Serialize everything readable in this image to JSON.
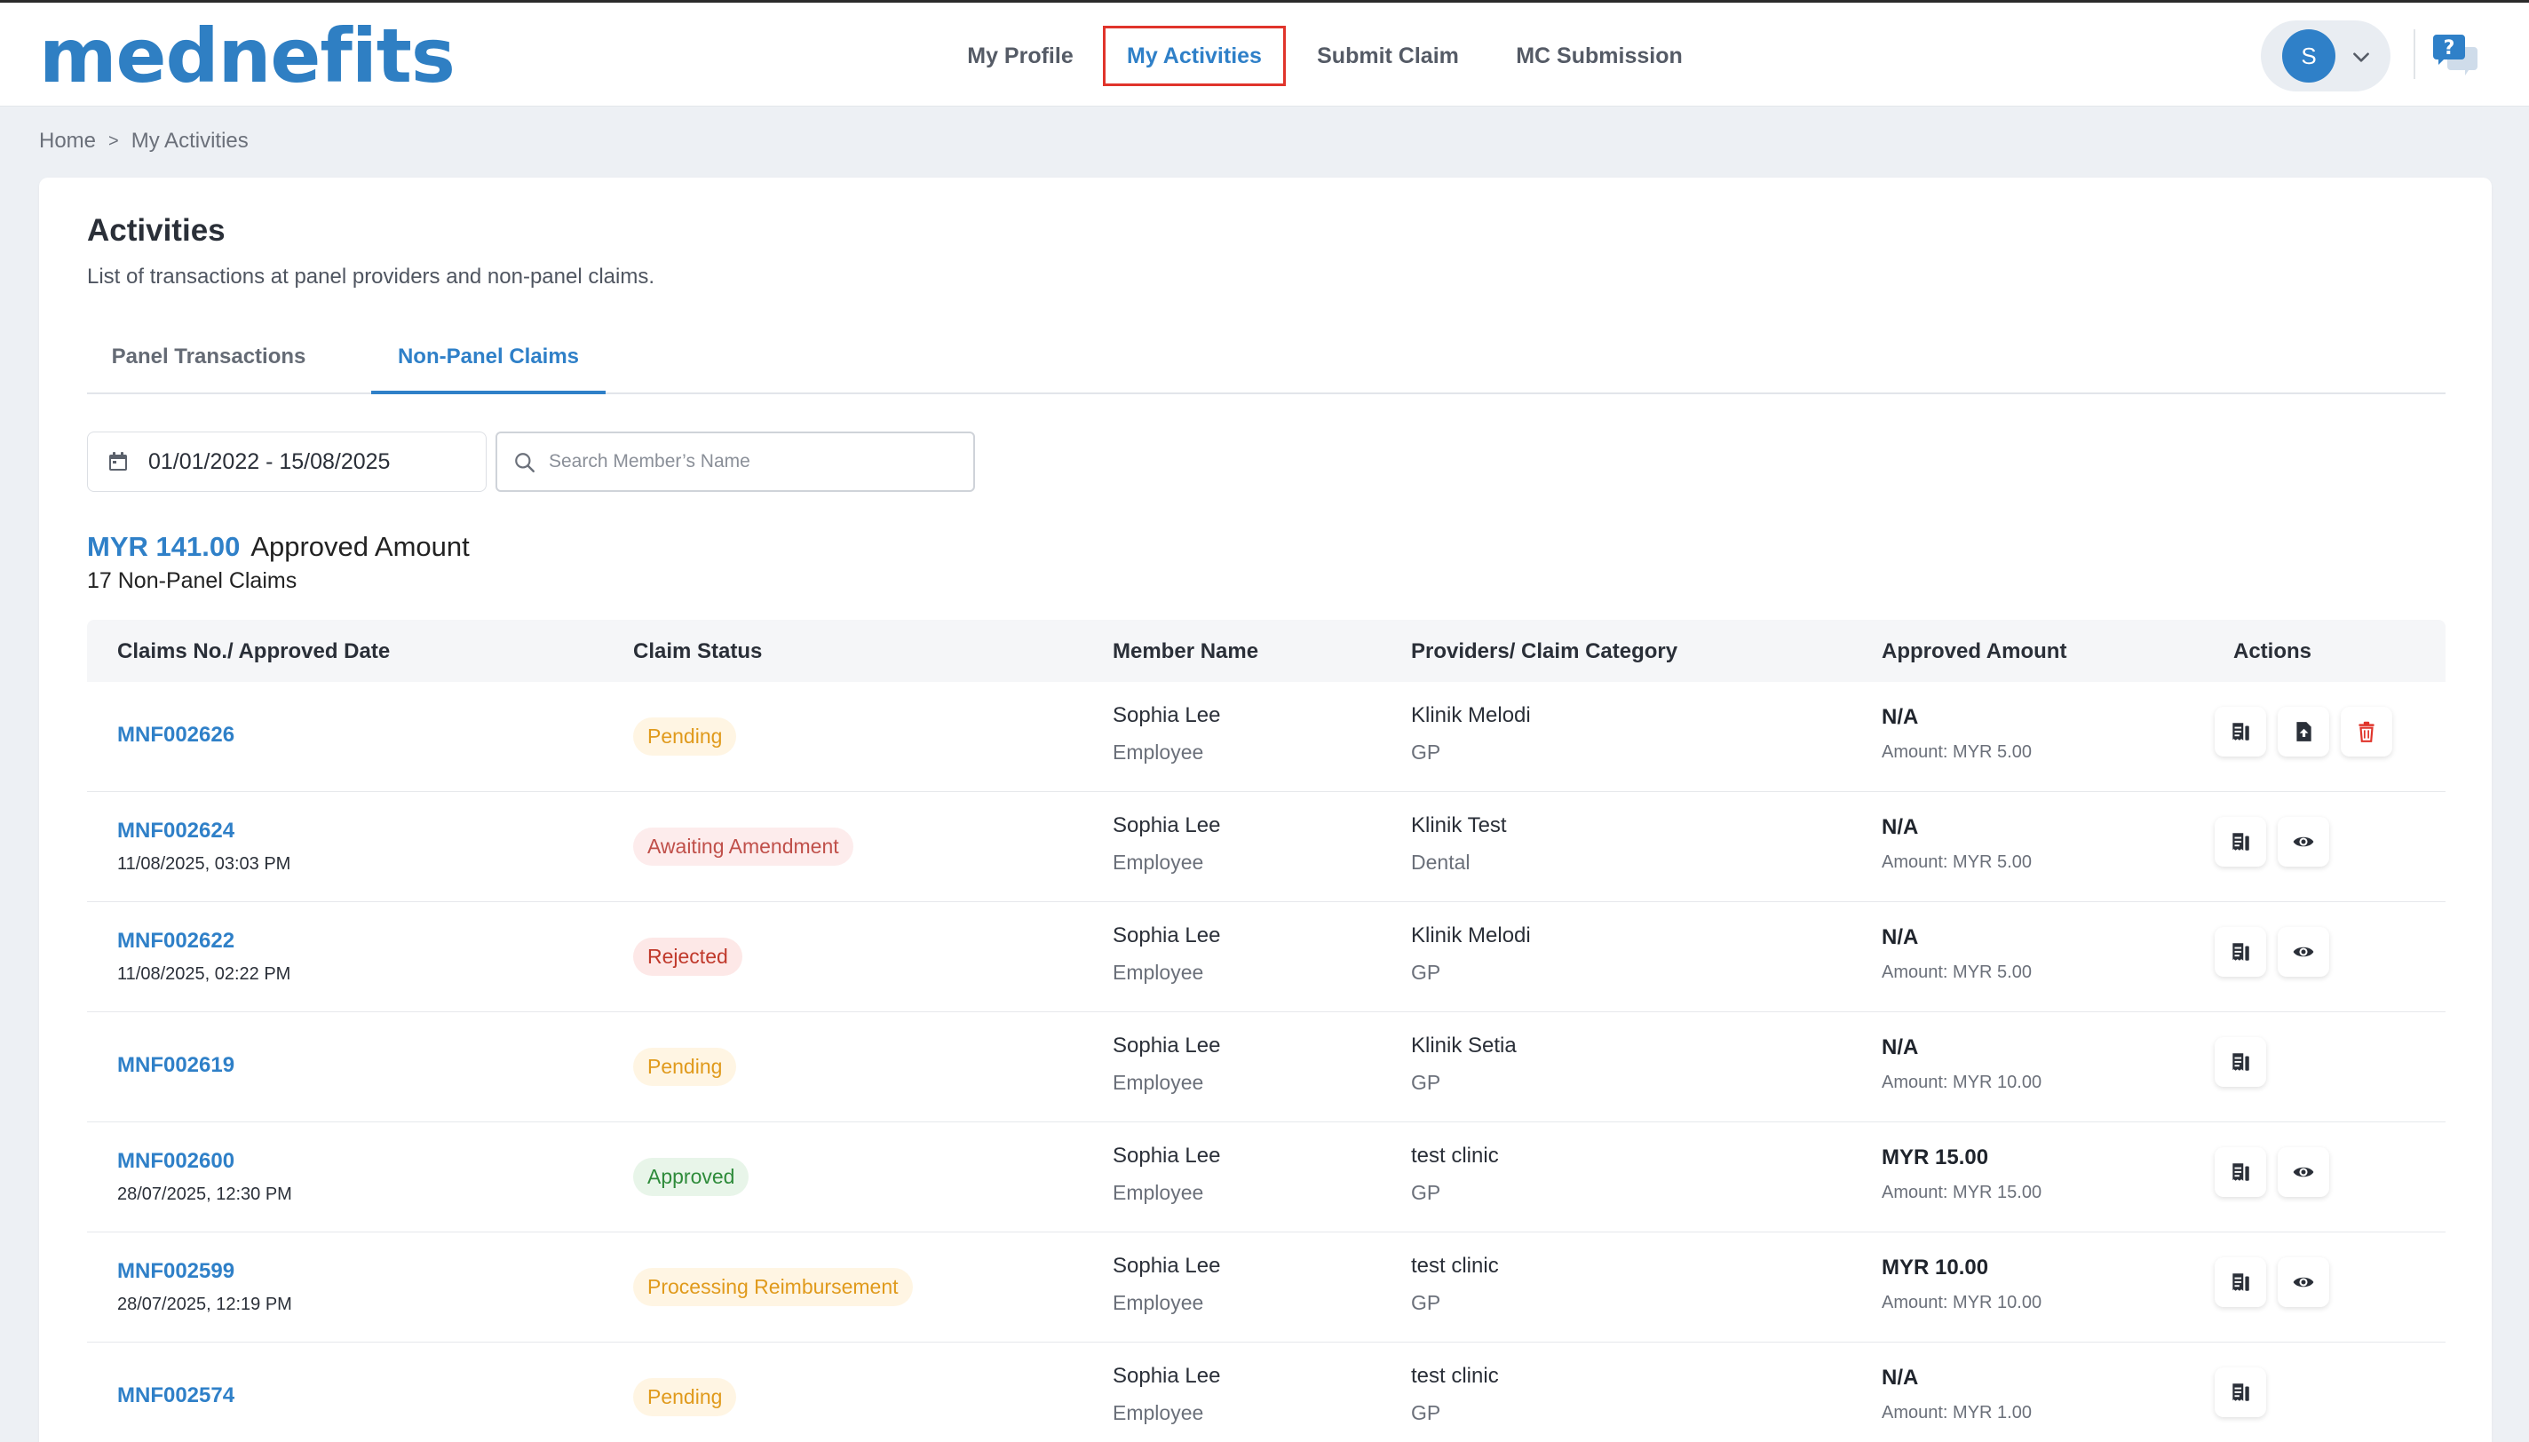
{
  "header": {
    "logo": "mednefits",
    "nav": [
      {
        "label": "My Profile",
        "active": false
      },
      {
        "label": "My Activities",
        "active": true
      },
      {
        "label": "Submit Claim",
        "active": false
      },
      {
        "label": "MC Submission",
        "active": false
      }
    ],
    "user_initial": "S"
  },
  "breadcrumb": {
    "home": "Home",
    "separator": ">",
    "current": "My Activities"
  },
  "page": {
    "title": "Activities",
    "subtitle": "List of transactions at panel providers and non-panel claims."
  },
  "tabs": [
    {
      "label": "Panel Transactions",
      "active": false
    },
    {
      "label": "Non-Panel Claims",
      "active": true
    }
  ],
  "filters": {
    "date_range": "01/01/2022 - 15/08/2025",
    "search_placeholder": "Search Member’s Name"
  },
  "summary": {
    "approved_amount": "MYR 141.00",
    "approved_label": "Approved Amount",
    "count_label": "17 Non-Panel Claims"
  },
  "table": {
    "headers": [
      "Claims No./ Approved Date",
      "Claim Status",
      "Member Name",
      "Providers/ Claim Category",
      "Approved Amount",
      "Actions"
    ],
    "rows": [
      {
        "claim_no": "MNF002626",
        "date": "",
        "status": "Pending",
        "status_type": "pending",
        "member": "Sophia Lee",
        "member_type": "Employee",
        "provider": "Klinik Melodi",
        "category": "GP",
        "approved": "N/A",
        "amount": "Amount: MYR 5.00",
        "actions": [
          "receipt",
          "upload",
          "delete"
        ]
      },
      {
        "claim_no": "MNF002624",
        "date": "11/08/2025, 03:03 PM",
        "status": "Awaiting Amendment",
        "status_type": "await",
        "member": "Sophia Lee",
        "member_type": "Employee",
        "provider": "Klinik Test",
        "category": "Dental",
        "approved": "N/A",
        "amount": "Amount: MYR 5.00",
        "actions": [
          "receipt",
          "view"
        ]
      },
      {
        "claim_no": "MNF002622",
        "date": "11/08/2025, 02:22 PM",
        "status": "Rejected",
        "status_type": "rejected",
        "member": "Sophia Lee",
        "member_type": "Employee",
        "provider": "Klinik Melodi",
        "category": "GP",
        "approved": "N/A",
        "amount": "Amount: MYR 5.00",
        "actions": [
          "receipt",
          "view"
        ]
      },
      {
        "claim_no": "MNF002619",
        "date": "",
        "status": "Pending",
        "status_type": "pending",
        "member": "Sophia Lee",
        "member_type": "Employee",
        "provider": "Klinik Setia",
        "category": "GP",
        "approved": "N/A",
        "amount": "Amount: MYR 10.00",
        "actions": [
          "receipt"
        ]
      },
      {
        "claim_no": "MNF002600",
        "date": "28/07/2025, 12:30 PM",
        "status": "Approved",
        "status_type": "approved",
        "member": "Sophia Lee",
        "member_type": "Employee",
        "provider": "test clinic",
        "category": "GP",
        "approved": "MYR 15.00",
        "amount": "Amount: MYR 15.00",
        "actions": [
          "receipt",
          "view"
        ]
      },
      {
        "claim_no": "MNF002599",
        "date": "28/07/2025, 12:19 PM",
        "status": "Processing Reimbursement",
        "status_type": "processing",
        "member": "Sophia Lee",
        "member_type": "Employee",
        "provider": "test clinic",
        "category": "GP",
        "approved": "MYR 10.00",
        "amount": "Amount: MYR 10.00",
        "actions": [
          "receipt",
          "view"
        ]
      },
      {
        "claim_no": "MNF002574",
        "date": "",
        "status": "Pending",
        "status_type": "pending",
        "member": "Sophia Lee",
        "member_type": "Employee",
        "provider": "test clinic",
        "category": "GP",
        "approved": "N/A",
        "amount": "Amount: MYR 1.00",
        "actions": [
          "receipt"
        ]
      }
    ]
  },
  "colors": {
    "accent": "#2f80c8",
    "highlight": "#e0342b",
    "delete": "#e0342b"
  }
}
